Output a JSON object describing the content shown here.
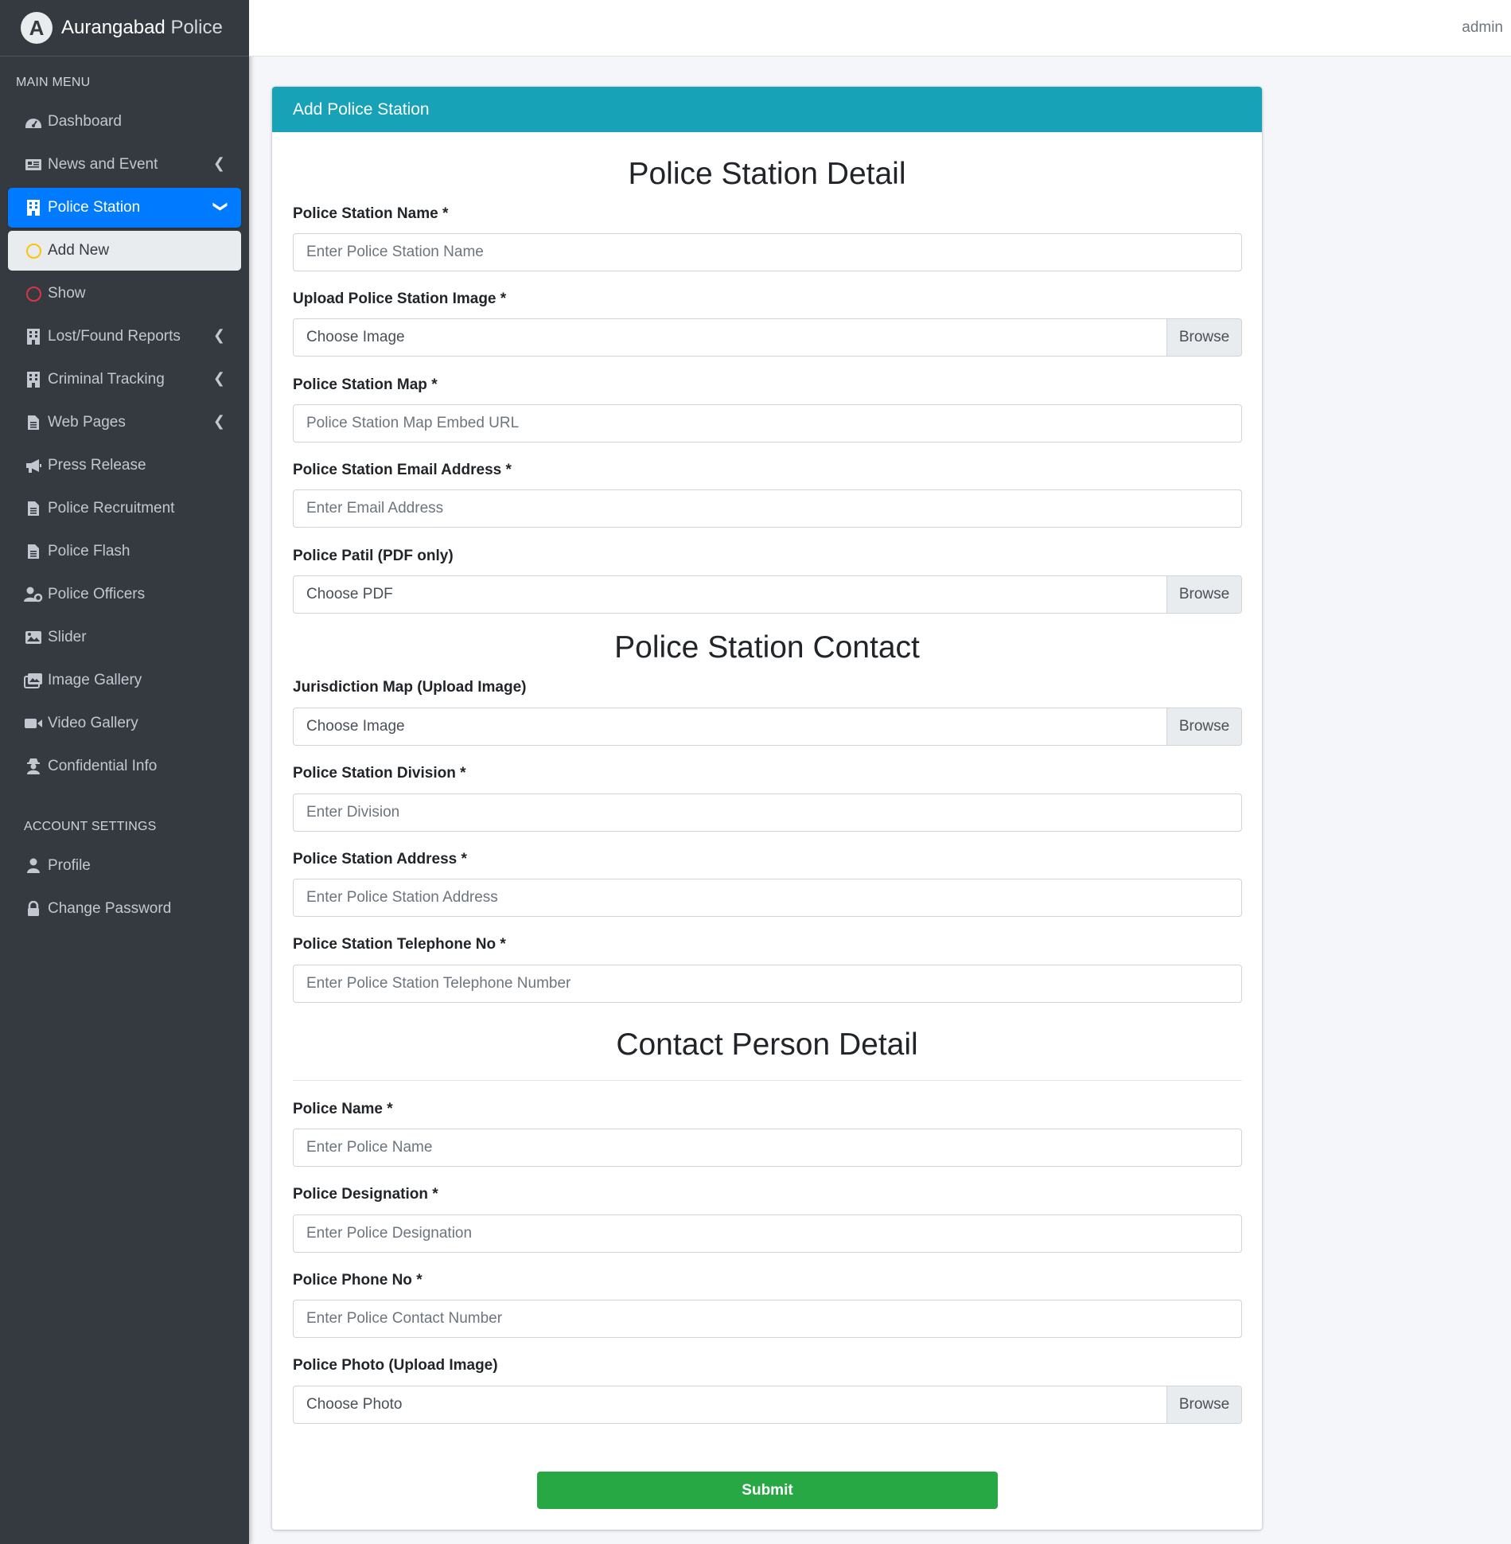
{
  "brand": {
    "name_bold": "Aurangabad",
    "name_light": " Police",
    "logo_letter": "A"
  },
  "topbar": {
    "user": "admin"
  },
  "sidebar": {
    "main_header": "MAIN MENU",
    "account_header": "ACCOUNT SETTINGS",
    "items": [
      {
        "label": "Dashboard",
        "icon": "dashboard-icon"
      },
      {
        "label": "News and Event",
        "icon": "newspaper-icon"
      },
      {
        "label": "Police Station",
        "icon": "building-icon"
      },
      {
        "label": "Add New",
        "icon": "circle-icon"
      },
      {
        "label": "Show",
        "icon": "circle-icon"
      },
      {
        "label": "Lost/Found Reports",
        "icon": "building-icon"
      },
      {
        "label": "Criminal Tracking",
        "icon": "building-icon"
      },
      {
        "label": "Web Pages",
        "icon": "file-icon"
      },
      {
        "label": "Press Release",
        "icon": "megaphone-icon"
      },
      {
        "label": "Police Recruitment",
        "icon": "file-icon"
      },
      {
        "label": "Police Flash",
        "icon": "file-icon"
      },
      {
        "label": "Police Officers",
        "icon": "user-cog-icon"
      },
      {
        "label": "Slider",
        "icon": "image-icon"
      },
      {
        "label": "Image Gallery",
        "icon": "images-icon"
      },
      {
        "label": "Video Gallery",
        "icon": "video-icon"
      },
      {
        "label": "Confidential Info",
        "icon": "user-secret-icon"
      }
    ],
    "account_items": [
      {
        "label": "Profile",
        "icon": "user-icon"
      },
      {
        "label": "Change Password",
        "icon": "lock-icon"
      }
    ]
  },
  "card": {
    "header": "Add Police Station"
  },
  "sections": {
    "detail": "Police Station Detail",
    "contact": "Police Station Contact",
    "person": "Contact Person Detail"
  },
  "fields": {
    "station_name": {
      "label": "Police Station Name *",
      "placeholder": "Enter Police Station Name"
    },
    "station_image": {
      "label": "Upload Police Station Image *",
      "text": "Choose Image",
      "button": "Browse"
    },
    "station_map": {
      "label": "Police Station Map *",
      "placeholder": "Police Station Map Embed URL"
    },
    "station_email": {
      "label": "Police Station Email Address *",
      "placeholder": "Enter Email Address"
    },
    "police_patil": {
      "label": "Police Patil (PDF only)",
      "text": "Choose PDF",
      "button": "Browse"
    },
    "jurisdiction_map": {
      "label": "Jurisdiction Map (Upload Image)",
      "text": "Choose Image",
      "button": "Browse"
    },
    "division": {
      "label": "Police Station Division *",
      "placeholder": "Enter Division"
    },
    "address": {
      "label": "Police Station Address *",
      "placeholder": "Enter Police Station Address"
    },
    "telephone": {
      "label": "Police Station Telephone No *",
      "placeholder": "Enter Police Station Telephone Number"
    },
    "police_name": {
      "label": "Police Name *",
      "placeholder": "Enter Police Name"
    },
    "designation": {
      "label": "Police Designation *",
      "placeholder": "Enter Police Designation"
    },
    "phone": {
      "label": "Police Phone No *",
      "placeholder": "Enter Police Contact Number"
    },
    "photo": {
      "label": "Police Photo (Upload Image)",
      "text": "Choose Photo",
      "button": "Browse"
    }
  },
  "submit_label": "Submit",
  "colors": {
    "sidebar_bg": "#343a40",
    "active_blue": "#007bff",
    "header_teal": "#17a2b8",
    "submit_green": "#28a745",
    "add_new_circle": "#ffc107",
    "show_circle": "#dc3545"
  }
}
